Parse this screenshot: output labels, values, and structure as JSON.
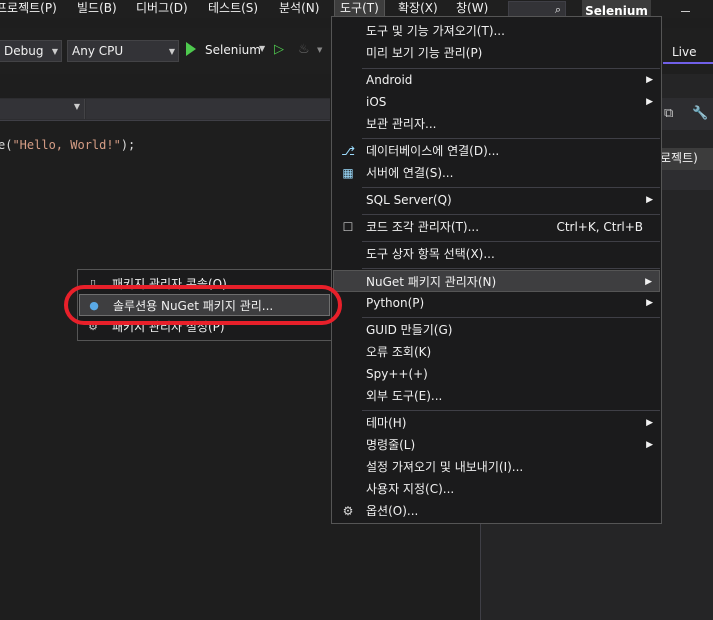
{
  "menubar": {
    "items": [
      "프로젝트(P)",
      "빌드(B)",
      "디버그(D)",
      "테스트(S)",
      "분석(N)",
      "도구(T)",
      "확장(X)",
      "창(W)"
    ],
    "search_icon": "search-icon",
    "solution_name": "Selenium"
  },
  "toolbar": {
    "config": "Debug",
    "platform": "Any CPU",
    "run_target": "Selenium",
    "live_share": "Live"
  },
  "editor": {
    "code_prefix": "e(",
    "code_string": "\"Hello, World!\"",
    "code_suffix": ");"
  },
  "right_panel": {
    "tab_label": "로젝트)"
  },
  "tools_menu": {
    "items": [
      {
        "label": "도구 및 기능 가져오기(T)..."
      },
      {
        "label": "미리 보기 기능 관리(P)"
      },
      {
        "label": "Android",
        "submenu": true
      },
      {
        "label": "iOS",
        "submenu": true
      },
      {
        "label": "보관 관리자..."
      },
      {
        "label": "데이터베이스에 연결(D)...",
        "icon": "database-connect-icon"
      },
      {
        "label": "서버에 연결(S)...",
        "icon": "server-connect-icon"
      },
      {
        "label": "SQL Server(Q)",
        "submenu": true
      },
      {
        "label": "코드 조각 관리자(T)...",
        "shortcut": "Ctrl+K, Ctrl+B",
        "icon": "checkbox-icon"
      },
      {
        "label": "도구 상자 항목 선택(X)..."
      },
      {
        "label": "NuGet 패키지 관리자(N)",
        "submenu": true,
        "highlighted": true
      },
      {
        "label": "Python(P)",
        "submenu": true
      },
      {
        "label": "GUID 만들기(G)"
      },
      {
        "label": "오류 조회(K)"
      },
      {
        "label": "Spy++(+)"
      },
      {
        "label": "외부 도구(E)..."
      },
      {
        "label": "테마(H)",
        "submenu": true
      },
      {
        "label": "명령줄(L)",
        "submenu": true
      },
      {
        "label": "설정 가져오기 및 내보내기(I)..."
      },
      {
        "label": "사용자 지정(C)..."
      },
      {
        "label": "옵션(O)...",
        "icon": "gear-icon"
      }
    ]
  },
  "nuget_submenu": {
    "items": [
      {
        "label": "패키지 관리자 콘솔(O)",
        "icon": "console-icon"
      },
      {
        "label": "솔루션용 NuGet 패키지 관리...",
        "icon": "nuget-icon",
        "highlighted": true
      },
      {
        "label": "패키지 관리자 설정(P)",
        "icon": "gear-icon"
      }
    ]
  },
  "colors": {
    "highlight_ring": "#e8202a",
    "run_green": "#4ec94e",
    "live_accent": "#7160e8"
  }
}
